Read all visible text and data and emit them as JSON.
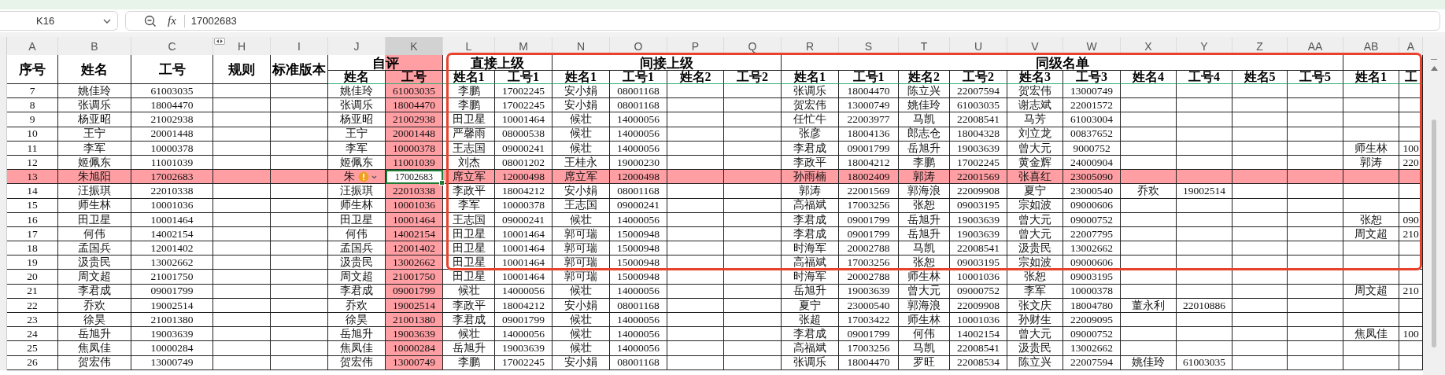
{
  "name_box": {
    "value": "K16"
  },
  "formula_bar": {
    "fx_label": "fx",
    "value": "17002683"
  },
  "columns": [
    {
      "letter": "A",
      "selected": false,
      "highlighted": false,
      "collapsed_after": false
    },
    {
      "letter": "B",
      "selected": false,
      "highlighted": false,
      "collapsed_after": false
    },
    {
      "letter": "C",
      "selected": false,
      "highlighted": false,
      "collapsed_after": true
    },
    {
      "letter": "H",
      "selected": false,
      "highlighted": false,
      "collapsed_after": false
    },
    {
      "letter": "I",
      "selected": false,
      "highlighted": false,
      "collapsed_after": false
    },
    {
      "letter": "J",
      "selected": false,
      "highlighted": false,
      "collapsed_after": false
    },
    {
      "letter": "K",
      "selected": true,
      "highlighted": true,
      "collapsed_after": false
    },
    {
      "letter": "L",
      "selected": false,
      "highlighted": false,
      "collapsed_after": false
    },
    {
      "letter": "M",
      "selected": false,
      "highlighted": false,
      "collapsed_after": false
    },
    {
      "letter": "N",
      "selected": false,
      "highlighted": false,
      "collapsed_after": false
    },
    {
      "letter": "O",
      "selected": false,
      "highlighted": false,
      "collapsed_after": false
    },
    {
      "letter": "P",
      "selected": false,
      "highlighted": false,
      "collapsed_after": false
    },
    {
      "letter": "Q",
      "selected": false,
      "highlighted": false,
      "collapsed_after": false
    },
    {
      "letter": "R",
      "selected": false,
      "highlighted": false,
      "collapsed_after": false
    },
    {
      "letter": "S",
      "selected": false,
      "highlighted": false,
      "collapsed_after": false
    },
    {
      "letter": "T",
      "selected": false,
      "highlighted": false,
      "collapsed_after": false
    },
    {
      "letter": "U",
      "selected": false,
      "highlighted": false,
      "collapsed_after": false
    },
    {
      "letter": "V",
      "selected": false,
      "highlighted": false,
      "collapsed_after": false
    },
    {
      "letter": "W",
      "selected": false,
      "highlighted": false,
      "collapsed_after": false
    },
    {
      "letter": "X",
      "selected": false,
      "highlighted": false,
      "collapsed_after": false
    },
    {
      "letter": "Y",
      "selected": false,
      "highlighted": false,
      "collapsed_after": false
    },
    {
      "letter": "Z",
      "selected": false,
      "highlighted": false,
      "collapsed_after": false
    },
    {
      "letter": "AA",
      "selected": false,
      "highlighted": false,
      "collapsed_after": false
    },
    {
      "letter": "AB",
      "selected": false,
      "highlighted": false,
      "collapsed_after": false
    },
    {
      "letter": "A",
      "selected": false,
      "highlighted": false,
      "collapsed_after": false
    }
  ],
  "header": [
    {
      "kind": "single",
      "label": "序号"
    },
    {
      "kind": "single",
      "label": "姓名"
    },
    {
      "kind": "single",
      "label": "工号"
    },
    {
      "kind": "single",
      "label": "规则"
    },
    {
      "kind": "single",
      "label": "标准版本"
    },
    {
      "kind": "group",
      "label": "自评",
      "columns": [
        "姓名",
        "工号"
      ]
    },
    {
      "kind": "group",
      "label": "直接上级",
      "columns": [
        "姓名1",
        "工号1"
      ]
    },
    {
      "kind": "group",
      "label": "间接上级",
      "columns": [
        "姓名1",
        "工号1",
        "姓名2",
        "工号2"
      ]
    },
    {
      "kind": "group",
      "label": "同级名单",
      "columns": [
        "姓名1",
        "工号1",
        "姓名2",
        "工号2",
        "姓名3",
        "工号3",
        "姓名4",
        "工号4",
        "姓名5",
        "工号5"
      ]
    },
    {
      "kind": "group",
      "columns": [
        "姓名1",
        "工"
      ]
    }
  ],
  "rows": [
    {
      "selected": false,
      "active": false,
      "warning": false,
      "cells": [
        "7",
        "姚佳玲",
        "61003035",
        null,
        null,
        "姚佳玲",
        "61003035",
        "李鹏",
        "17002245",
        "安小娟",
        "08001168",
        null,
        null,
        "张调乐",
        "18004470",
        "陈立兴",
        "22007594",
        "贺宏伟",
        "13000749",
        null,
        null,
        null,
        null,
        null,
        null
      ]
    },
    {
      "selected": false,
      "active": false,
      "warning": false,
      "cells": [
        "8",
        "张调乐",
        "18004470",
        null,
        null,
        "张调乐",
        "18004470",
        "李鹏",
        "17002245",
        "安小娟",
        "08001168",
        null,
        null,
        "贺宏伟",
        "13000749",
        "姚佳玲",
        "61003035",
        "谢志斌",
        "22001572",
        null,
        null,
        null,
        null,
        null,
        null
      ]
    },
    {
      "selected": false,
      "active": false,
      "warning": false,
      "cells": [
        "9",
        "杨亚昭",
        "21002938",
        null,
        null,
        "杨亚昭",
        "21002938",
        "田卫星",
        "10001464",
        "候壮",
        "14000056",
        null,
        null,
        "任忙牛",
        "22003977",
        "马凯",
        "22008541",
        "马芳",
        "61003004",
        null,
        null,
        null,
        null,
        null,
        null
      ]
    },
    {
      "selected": false,
      "active": false,
      "warning": false,
      "cells": [
        "10",
        "王宁",
        "20001448",
        null,
        null,
        "王宁",
        "20001448",
        "严馨雨",
        "08000538",
        "候壮",
        "14000056",
        null,
        null,
        "张彦",
        "18004136",
        "郎志仓",
        "18004328",
        "刘立龙",
        "00837652",
        null,
        null,
        null,
        null,
        null,
        null
      ]
    },
    {
      "selected": false,
      "active": false,
      "warning": false,
      "cells": [
        "11",
        "李军",
        "10000378",
        null,
        null,
        "李军",
        "10000378",
        "王志国",
        "09000241",
        "候壮",
        "14000056",
        null,
        null,
        "李君成",
        "09001799",
        "岳旭升",
        "19003639",
        "曾大元",
        "9000752",
        null,
        null,
        null,
        null,
        "师生林",
        "100"
      ]
    },
    {
      "selected": false,
      "active": false,
      "warning": false,
      "cells": [
        "12",
        "姬佩东",
        "11001039",
        null,
        null,
        "姬佩东",
        "11001039",
        "刘杰",
        "08001202",
        "王桂永",
        "19000230",
        null,
        null,
        "李政平",
        "18004212",
        "李鹏",
        "17002245",
        "黄金辉",
        "24000904",
        null,
        null,
        null,
        null,
        "郭涛",
        "220"
      ]
    },
    {
      "selected": true,
      "active": true,
      "warning": true,
      "cells": [
        "13",
        "朱旭阳",
        "17002683",
        null,
        null,
        "朱",
        "17002683",
        "席立军",
        "12000498",
        "席立军",
        "12000498",
        null,
        null,
        "孙雨楠",
        "18002409",
        "郭涛",
        "22001569",
        "张喜红",
        "23005090",
        null,
        null,
        null,
        null,
        null,
        null
      ]
    },
    {
      "selected": false,
      "active": false,
      "warning": false,
      "cells": [
        "14",
        "汪振琪",
        "22010338",
        null,
        null,
        "汪振琪",
        "22010338",
        "李政平",
        "18004212",
        "安小娟",
        "08001168",
        null,
        null,
        "郭涛",
        "22001569",
        "郭海浪",
        "22009908",
        "夏宁",
        "23000540",
        "乔欢",
        "19002514",
        null,
        null,
        null,
        null
      ]
    },
    {
      "selected": false,
      "active": false,
      "warning": false,
      "cells": [
        "15",
        "师生林",
        "10001036",
        null,
        null,
        "师生林",
        "10001036",
        "李军",
        "10000378",
        "王志国",
        "09000241",
        null,
        null,
        "高福斌",
        "17003256",
        "张恕",
        "09003195",
        "宗如波",
        "09000606",
        null,
        null,
        null,
        null,
        null,
        null
      ]
    },
    {
      "selected": false,
      "active": false,
      "warning": false,
      "cells": [
        "16",
        "田卫星",
        "10001464",
        null,
        null,
        "田卫星",
        "10001464",
        "王志国",
        "09000241",
        "候壮",
        "14000056",
        null,
        null,
        "李君成",
        "09001799",
        "岳旭升",
        "19003639",
        "曾大元",
        "09000752",
        null,
        null,
        null,
        null,
        "张恕",
        "090"
      ]
    },
    {
      "selected": false,
      "active": false,
      "warning": false,
      "cells": [
        "17",
        "何伟",
        "14002154",
        null,
        null,
        "何伟",
        "14002154",
        "田卫星",
        "10001464",
        "郭可瑞",
        "15000948",
        null,
        null,
        "李君成",
        "09001799",
        "岳旭升",
        "19003639",
        "曾大元",
        "22007795",
        null,
        null,
        null,
        null,
        "周文超",
        "210"
      ]
    },
    {
      "selected": false,
      "active": false,
      "warning": false,
      "cells": [
        "18",
        "孟国兵",
        "12001402",
        null,
        null,
        "孟国兵",
        "12001402",
        "田卫星",
        "10001464",
        "郭可瑞",
        "15000948",
        null,
        null,
        "时海军",
        "20002788",
        "马凯",
        "22008541",
        "汲贵民",
        "13002662",
        null,
        null,
        null,
        null,
        null,
        null
      ]
    },
    {
      "selected": false,
      "active": false,
      "warning": false,
      "cells": [
        "19",
        "汲贵民",
        "13002662",
        null,
        null,
        "汲贵民",
        "13002662",
        "田卫星",
        "10001464",
        "郭可瑞",
        "15000948",
        null,
        null,
        "高福斌",
        "17003256",
        "张恕",
        "09003195",
        "宗如波",
        "09000606",
        null,
        null,
        null,
        null,
        null,
        null
      ]
    },
    {
      "selected": false,
      "active": false,
      "warning": false,
      "cells": [
        "20",
        "周文超",
        "21001750",
        null,
        null,
        "周文超",
        "21001750",
        "田卫星",
        "10001464",
        "郭可瑞",
        "15000948",
        null,
        null,
        "时海军",
        "20002788",
        "师生林",
        "10001036",
        "张恕",
        "09003195",
        null,
        null,
        null,
        null,
        null,
        null
      ]
    },
    {
      "selected": false,
      "active": false,
      "warning": false,
      "cells": [
        "21",
        "李君成",
        "09001799",
        null,
        null,
        "李君成",
        "09001799",
        "候壮",
        "14000056",
        "候壮",
        "14000056",
        null,
        null,
        "岳旭升",
        "19003639",
        "曾大元",
        "09000752",
        "李军",
        "10000378",
        null,
        null,
        null,
        null,
        "周文超",
        "210"
      ]
    },
    {
      "selected": false,
      "active": false,
      "warning": false,
      "cells": [
        "22",
        "乔欢",
        "19002514",
        null,
        null,
        "乔欢",
        "19002514",
        "李政平",
        "18004212",
        "安小娟",
        "08001168",
        null,
        null,
        "夏宁",
        "23000540",
        "郭海浪",
        "22009908",
        "张文庆",
        "18004780",
        "董永利",
        "22010886",
        null,
        null,
        null,
        null
      ]
    },
    {
      "selected": false,
      "active": false,
      "warning": false,
      "cells": [
        "23",
        "徐昊",
        "21001380",
        null,
        null,
        "徐昊",
        "21001380",
        "李君成",
        "09001799",
        "候壮",
        "14000056",
        null,
        null,
        "张超",
        "17003422",
        "师生林",
        "10001036",
        "孙财生",
        "22009095",
        null,
        null,
        null,
        null,
        null,
        null
      ]
    },
    {
      "selected": false,
      "active": false,
      "warning": false,
      "cells": [
        "24",
        "岳旭升",
        "19003639",
        null,
        null,
        "岳旭升",
        "19003639",
        "候壮",
        "14000056",
        "候壮",
        "14000056",
        null,
        null,
        "李君成",
        "09001799",
        "何伟",
        "14002154",
        "曾大元",
        "09000752",
        null,
        null,
        null,
        null,
        "焦凤佳",
        "100"
      ]
    },
    {
      "selected": false,
      "active": false,
      "warning": false,
      "cells": [
        "25",
        "焦凤佳",
        "10000284",
        null,
        null,
        "焦凤佳",
        "10000284",
        "岳旭升",
        "19003639",
        "候壮",
        "14000056",
        null,
        null,
        "高福斌",
        "17003256",
        "马凯",
        "22008541",
        "汲贵民",
        "13002662",
        null,
        null,
        null,
        null,
        null,
        null
      ]
    },
    {
      "selected": false,
      "active": false,
      "warning": false,
      "cells": [
        "26",
        "贺宏伟",
        "13000749",
        null,
        null,
        "贺宏伟",
        "13000749",
        "李鹏",
        "17002245",
        "安小娟",
        "08001168",
        null,
        null,
        "张调乐",
        "18004470",
        "罗旺",
        "22008534",
        "陈立兴",
        "22007594",
        "姚佳玲",
        "61003035",
        null,
        null,
        null,
        null
      ]
    }
  ],
  "annotation": {
    "kind": "frame",
    "color": "#e8412c"
  }
}
